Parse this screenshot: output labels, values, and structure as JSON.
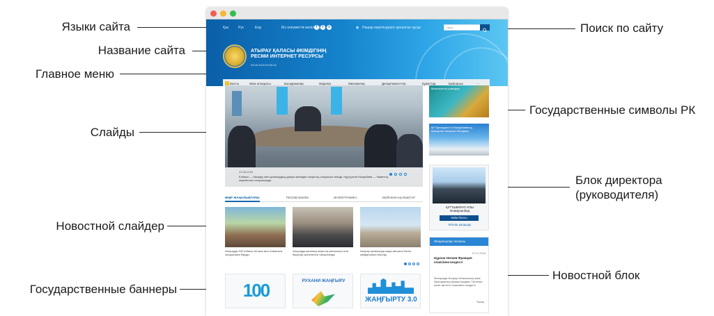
{
  "callouts": {
    "languages": "Языки сайта",
    "site_name": "Название сайта",
    "main_menu": "Главное меню",
    "slides": "Слайды",
    "news_slider": "Новостной слайдер",
    "gov_banners": "Государственные баннеры",
    "search": "Поиск по сайту",
    "gov_symbols": "Государственные символы РК",
    "director_block_line1": "Блок директора",
    "director_block_line2": "(руководителя)",
    "news_block": "Новостной блок"
  },
  "window_dots": [
    "#f25c54",
    "#f7b733",
    "#31c04d"
  ],
  "site": {
    "languages": [
      "Қаз",
      "Рус",
      "Eng"
    ],
    "social_label": "Біз әлеуметтік желілерде",
    "social_icons": [
      "facebook-icon",
      "twitter-icon",
      "vk-icon"
    ],
    "accessibility": "Нашар көретіндерге арналған нұсқа",
    "search_placeholder": "Іздеу",
    "title_line1": "АТЫРАУ ҚАЛАСЫ ӘКІМДІГІНІҢ",
    "title_line2": "РЕСМИ ИНТЕРНЕТ РЕСУРСЫ",
    "date": "09.05.2018     09:53:15",
    "menu": [
      "Басты",
      "Әкім аппараты",
      "Басқармалар",
      "Өңірлер",
      "Мекемелер",
      "Департаменттер",
      "Құжаттар",
      "Байланыс",
      "···"
    ],
    "slide": {
      "date": "22.08.2018",
      "text": "Елбасы — басқару мен қалалардың дамуы жөніндегі кеңестің отырысын өткізді. Нұрсұлтан Назарбаев — Үкіметтің кеңейтілген отырысында"
    },
    "tabs": [
      "ӨҢІР ЖАҢАЛЫҚТАРЫ",
      "РЕСМИ БӨЛІМ",
      "ИНФОГРАФИКА",
      "БЕЙНЕЖАҢАЛЫҚТАР"
    ],
    "news": [
      {
        "text": "Атырауда 200 отбасы Астана мен Алматыға экскурсияға барды"
      },
      {
        "text": "Атырауда қалалық кеңестің жиналысы өтіп, бірқатар мәселелер талқыланды"
      },
      {
        "text": "Атырау қаласында жаңа автожол бөлігі пайдалануға берілді"
      }
    ],
    "banners": [
      "100",
      "РУХАНИ ЖАҢҒЫРУ",
      "ЖАҢҒЫРТУ 3.0"
    ],
    "symbols_label": "Мемлекеттік рәміздер",
    "address_label": "ҚР Президенті Н.Назарбаевтың Қазақстан халқына Жолдауы",
    "director": {
      "name_line1": "ҚҰТТЫМҰРАТ-ҰЛЫ",
      "name_line2": "Әлимұханбед",
      "blog_button": "Әкім блогы",
      "link": "Өтініш қалдыру"
    },
    "newsblock": {
      "header": "Жаңалықтар таспасы",
      "date": "17.07.2018",
      "title": "Нұрлан Ноғаев Франция елшісінен кездесті",
      "text": "Жоғарыда Атырау облысының әкімі Францияның Қазақстандағы Төтенше және өкілетті елшісімен кездесті",
      "more": "Толық"
    }
  }
}
